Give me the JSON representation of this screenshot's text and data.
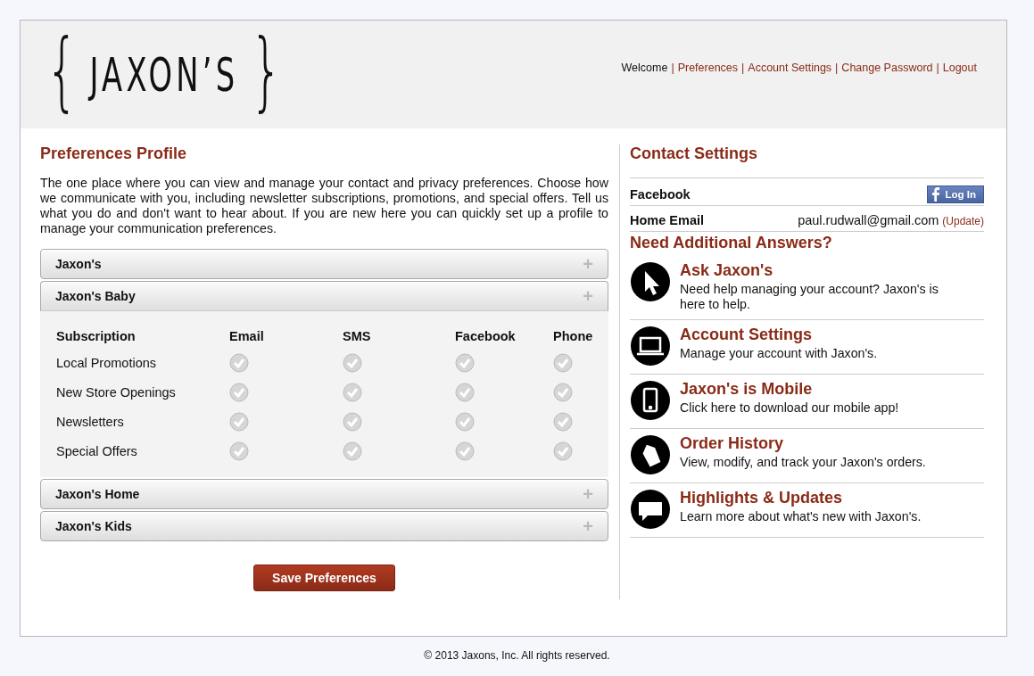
{
  "logo": {
    "brace_open": "{",
    "name": "JAXON’S",
    "brace_close": "}"
  },
  "top_nav": {
    "welcome": "Welcome",
    "separator": "|",
    "links": [
      "Preferences",
      "Account Settings",
      "Change Password",
      "Logout"
    ]
  },
  "preferences": {
    "title": "Preferences Profile",
    "intro": "The one place where you can view and manage your contact and privacy preferences. Choose how we communicate with you, including newsletter subscriptions, promotions, and special offers. Tell us what you do and don't want to hear about. If you are new here you can quickly set up a profile to manage your communication preferences.",
    "sections": [
      {
        "title": "Jaxon's",
        "expanded": false,
        "toggle": "+"
      },
      {
        "title": "Jaxon's Baby",
        "expanded": true,
        "toggle": "+",
        "columns": [
          "Subscription",
          "Email",
          "SMS",
          "Facebook",
          "Phone"
        ],
        "rows": [
          {
            "label": "Local Promotions",
            "channels": [
              {
                "checked": false
              },
              {
                "checked": false
              },
              {
                "checked": false
              },
              {
                "checked": false
              }
            ]
          },
          {
            "label": "New Store Openings",
            "channels": [
              {
                "checked": false
              },
              {
                "checked": false
              },
              {
                "checked": false
              },
              {
                "checked": false
              }
            ]
          },
          {
            "label": "Newsletters",
            "channels": [
              {
                "checked": false
              },
              {
                "checked": false
              },
              {
                "checked": false
              },
              {
                "checked": false
              }
            ]
          },
          {
            "label": "Special Offers",
            "channels": [
              {
                "checked": false
              },
              {
                "checked": false
              },
              {
                "checked": false
              },
              {
                "checked": false
              }
            ]
          }
        ]
      },
      {
        "title": "Jaxon's Home",
        "expanded": false,
        "toggle": "+"
      },
      {
        "title": "Jaxon's Kids",
        "expanded": false,
        "toggle": "+"
      }
    ],
    "save_button": "Save Preferences"
  },
  "contact": {
    "title": "Contact Settings",
    "facebook": {
      "label": "Facebook",
      "button": "Log In"
    },
    "home_email": {
      "label": "Home Email",
      "value": "paul.rudwall@gmail.com",
      "action": "(Update)"
    }
  },
  "answers": {
    "title": "Need Additional Answers?",
    "items": [
      {
        "kind": "cursor",
        "title": "Ask Jaxon's",
        "text": "Need help managing your account? Jaxon's is here to help."
      },
      {
        "kind": "laptop",
        "title": "Account Settings",
        "text": "Manage your account with Jaxon's."
      },
      {
        "kind": "mobile",
        "title": "Jaxon's is Mobile",
        "text": "Click here to download our mobile app!"
      },
      {
        "kind": "tag",
        "title": "Order History",
        "text": "View, modify, and track your Jaxon's orders."
      },
      {
        "kind": "chat",
        "title": "Highlights & Updates",
        "text": "Learn more about what's new with Jaxon's."
      }
    ]
  },
  "footer": "© 2013 Jaxons, Inc. All rights reserved."
}
